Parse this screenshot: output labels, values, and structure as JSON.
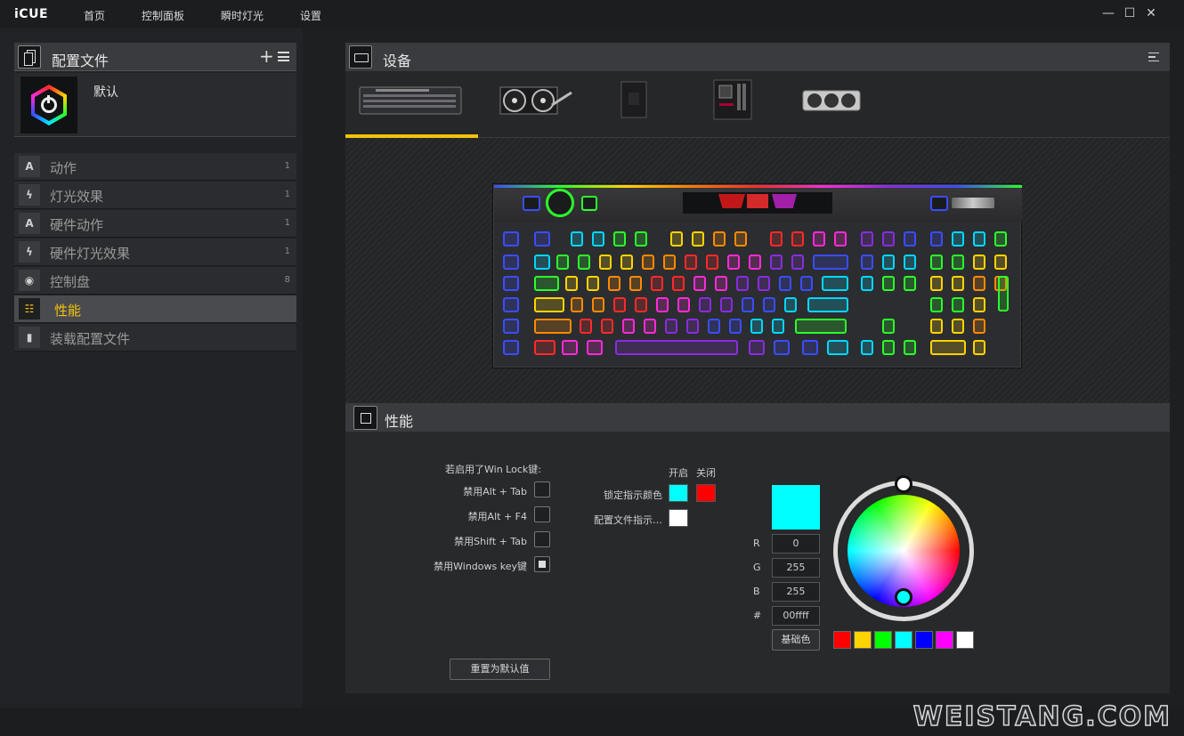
{
  "app": {
    "brand": "iCUE"
  },
  "nav": [
    "首页",
    "控制面板",
    "瞬时灯光",
    "设置"
  ],
  "profiles": {
    "title": "配置文件",
    "current_name": "默认"
  },
  "menu": [
    {
      "label": "动作",
      "count": "1",
      "icon": "A"
    },
    {
      "label": "灯光效果",
      "count": "1",
      "icon": "bolt-icon"
    },
    {
      "label": "硬件动作",
      "count": "1",
      "icon": "A"
    },
    {
      "label": "硬件灯光效果",
      "count": "1",
      "icon": "bolt-icon"
    },
    {
      "label": "控制盘",
      "count": "8",
      "icon": "dial-icon"
    },
    {
      "label": "性能",
      "count": "",
      "icon": "performance-icon"
    },
    {
      "label": "装载配置文件",
      "count": "",
      "icon": "file-icon"
    }
  ],
  "devices": {
    "title": "设备",
    "items": [
      "keyboard",
      "cooler",
      "controller",
      "motherboard",
      "gpu"
    ]
  },
  "performance": {
    "title": "性能",
    "winlock_title": "若启用了Win Lock键:",
    "options": [
      {
        "label": "禁用Alt + Tab",
        "checked": false
      },
      {
        "label": "禁用Alt + F4",
        "checked": false
      },
      {
        "label": "禁用Shift + Tab",
        "checked": false
      },
      {
        "label": "禁用Windows key键",
        "checked": true
      }
    ],
    "col_on": "开启",
    "col_off": "关闭",
    "lock_indicator_label": "锁定指示颜色",
    "profile_indicator_label": "配置文件指示…",
    "lock_on_color": "#00ffff",
    "lock_off_color": "#ff0000",
    "profile_color": "#ffffff",
    "reset_label": "重置为默认值"
  },
  "color_picker": {
    "preview_color": "#00ffff",
    "r_label": "R",
    "r_value": "0",
    "g_label": "G",
    "g_value": "255",
    "b_label": "B",
    "b_value": "255",
    "hex_label": "#",
    "hex_value": "00ffff",
    "base_color_label": "基础色",
    "palette": [
      "#ff0000",
      "#ffd400",
      "#00ff00",
      "#00ffff",
      "#0000ff",
      "#ff00ff",
      "#ffffff"
    ]
  },
  "watermark": "WEISTANG.COM"
}
